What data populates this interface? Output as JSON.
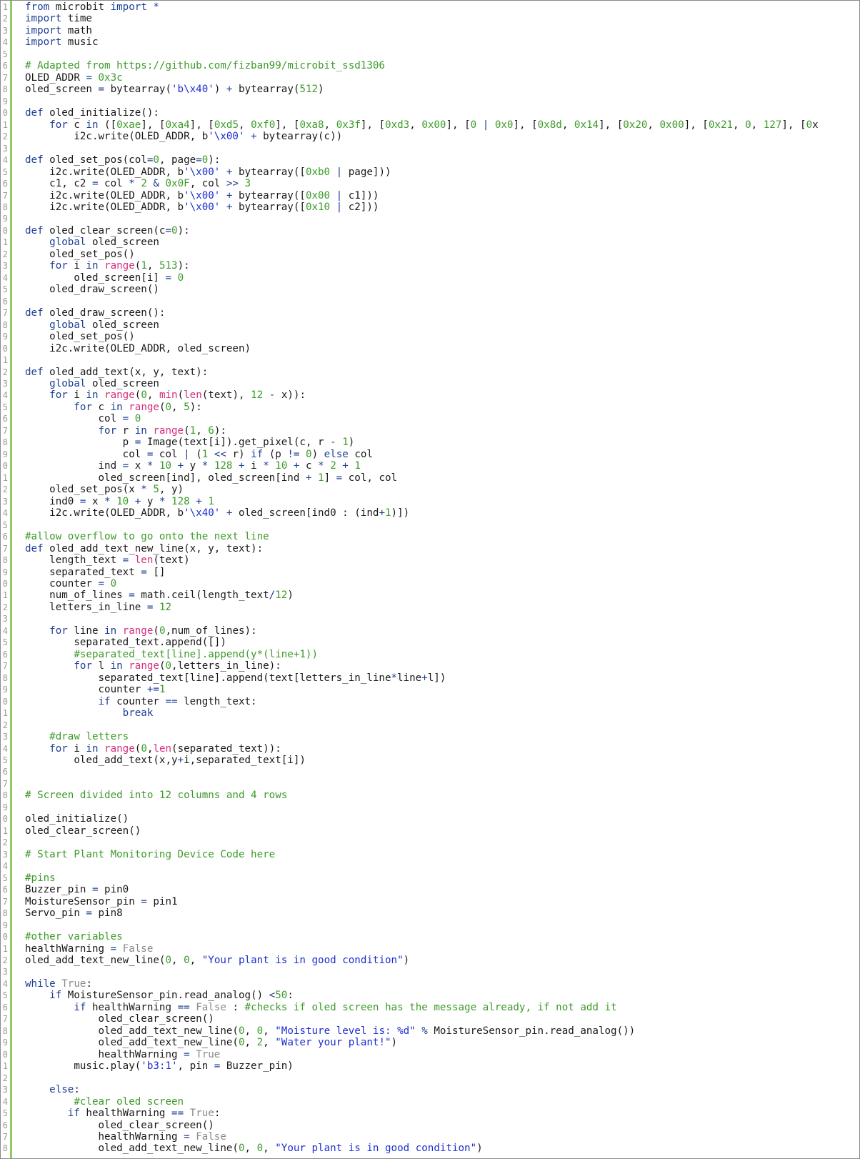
{
  "editor": {
    "language": "python",
    "colors": {
      "gutter_bar": "#8fca62",
      "keyword": "#1d3f95",
      "string": "#1b2fd0",
      "number": "#3d9b2a",
      "comment": "#3d9b2a",
      "builtin": "#d4307f",
      "literal": "#8a8a8a"
    },
    "lines": [
      {
        "n": "1",
        "t": "from microbit import *"
      },
      {
        "n": "2",
        "t": "import time"
      },
      {
        "n": "3",
        "t": "import math"
      },
      {
        "n": "4",
        "t": "import music"
      },
      {
        "n": "5",
        "t": ""
      },
      {
        "n": "6",
        "t": "# Adapted from https://github.com/fizban99/microbit_ssd1306"
      },
      {
        "n": "7",
        "t": "OLED_ADDR = 0x3c"
      },
      {
        "n": "8",
        "t": "oled_screen = bytearray('b\\x40') + bytearray(512)"
      },
      {
        "n": "9",
        "t": ""
      },
      {
        "n": "0",
        "t": "def oled_initialize():"
      },
      {
        "n": "1",
        "t": "    for c in ([0xae], [0xa4], [0xd5, 0xf0], [0xa8, 0x3f], [0xd3, 0x00], [0 | 0x0], [0x8d, 0x14], [0x20, 0x00], [0x21, 0, 127], [0x"
      },
      {
        "n": "2",
        "t": "        i2c.write(OLED_ADDR, b'\\x00' + bytearray(c))"
      },
      {
        "n": "3",
        "t": ""
      },
      {
        "n": "4",
        "t": "def oled_set_pos(col=0, page=0):"
      },
      {
        "n": "5",
        "t": "    i2c.write(OLED_ADDR, b'\\x00' + bytearray([0xb0 | page]))"
      },
      {
        "n": "6",
        "t": "    c1, c2 = col * 2 & 0x0F, col >> 3"
      },
      {
        "n": "7",
        "t": "    i2c.write(OLED_ADDR, b'\\x00' + bytearray([0x00 | c1]))"
      },
      {
        "n": "8",
        "t": "    i2c.write(OLED_ADDR, b'\\x00' + bytearray([0x10 | c2]))"
      },
      {
        "n": "9",
        "t": ""
      },
      {
        "n": "0",
        "t": "def oled_clear_screen(c=0):"
      },
      {
        "n": "1",
        "t": "    global oled_screen"
      },
      {
        "n": "2",
        "t": "    oled_set_pos()"
      },
      {
        "n": "3",
        "t": "    for i in range(1, 513):"
      },
      {
        "n": "4",
        "t": "        oled_screen[i] = 0"
      },
      {
        "n": "5",
        "t": "    oled_draw_screen()"
      },
      {
        "n": "6",
        "t": ""
      },
      {
        "n": "7",
        "t": "def oled_draw_screen():"
      },
      {
        "n": "8",
        "t": "    global oled_screen"
      },
      {
        "n": "9",
        "t": "    oled_set_pos()"
      },
      {
        "n": "0",
        "t": "    i2c.write(OLED_ADDR, oled_screen)"
      },
      {
        "n": "1",
        "t": ""
      },
      {
        "n": "2",
        "t": "def oled_add_text(x, y, text):"
      },
      {
        "n": "3",
        "t": "    global oled_screen"
      },
      {
        "n": "4",
        "t": "    for i in range(0, min(len(text), 12 - x)):"
      },
      {
        "n": "5",
        "t": "        for c in range(0, 5):"
      },
      {
        "n": "6",
        "t": "            col = 0"
      },
      {
        "n": "7",
        "t": "            for r in range(1, 6):"
      },
      {
        "n": "8",
        "t": "                p = Image(text[i]).get_pixel(c, r - 1)"
      },
      {
        "n": "9",
        "t": "                col = col | (1 << r) if (p != 0) else col"
      },
      {
        "n": "0",
        "t": "            ind = x * 10 + y * 128 + i * 10 + c * 2 + 1"
      },
      {
        "n": "1",
        "t": "            oled_screen[ind], oled_screen[ind + 1] = col, col"
      },
      {
        "n": "2",
        "t": "    oled_set_pos(x * 5, y)"
      },
      {
        "n": "3",
        "t": "    ind0 = x * 10 + y * 128 + 1"
      },
      {
        "n": "4",
        "t": "    i2c.write(OLED_ADDR, b'\\x40' + oled_screen[ind0 : (ind+1)])"
      },
      {
        "n": "5",
        "t": ""
      },
      {
        "n": "6",
        "t": "#allow overflow to go onto the next line"
      },
      {
        "n": "7",
        "t": "def oled_add_text_new_line(x, y, text):"
      },
      {
        "n": "8",
        "t": "    length_text = len(text)"
      },
      {
        "n": "9",
        "t": "    separated_text = []"
      },
      {
        "n": "0",
        "t": "    counter = 0"
      },
      {
        "n": "1",
        "t": "    num_of_lines = math.ceil(length_text/12)"
      },
      {
        "n": "2",
        "t": "    letters_in_line = 12"
      },
      {
        "n": "3",
        "t": ""
      },
      {
        "n": "4",
        "t": "    for line in range(0,num_of_lines):"
      },
      {
        "n": "5",
        "t": "        separated_text.append([])"
      },
      {
        "n": "6",
        "t": "        #separated_text[line].append(y*(line+1))"
      },
      {
        "n": "7",
        "t": "        for l in range(0,letters_in_line):"
      },
      {
        "n": "8",
        "t": "            separated_text[line].append(text[letters_in_line*line+l])"
      },
      {
        "n": "9",
        "t": "            counter +=1"
      },
      {
        "n": "0",
        "t": "            if counter == length_text:"
      },
      {
        "n": "1",
        "t": "                break"
      },
      {
        "n": "2",
        "t": ""
      },
      {
        "n": "3",
        "t": "    #draw letters"
      },
      {
        "n": "4",
        "t": "    for i in range(0,len(separated_text)):"
      },
      {
        "n": "5",
        "t": "        oled_add_text(x,y+i,separated_text[i])"
      },
      {
        "n": "6",
        "t": ""
      },
      {
        "n": "7",
        "t": ""
      },
      {
        "n": "8",
        "t": "# Screen divided into 12 columns and 4 rows"
      },
      {
        "n": "9",
        "t": ""
      },
      {
        "n": "0",
        "t": "oled_initialize()"
      },
      {
        "n": "1",
        "t": "oled_clear_screen()"
      },
      {
        "n": "2",
        "t": ""
      },
      {
        "n": "3",
        "t": "# Start Plant Monitoring Device Code here"
      },
      {
        "n": "4",
        "t": ""
      },
      {
        "n": "5",
        "t": "#pins"
      },
      {
        "n": "6",
        "t": "Buzzer_pin = pin0"
      },
      {
        "n": "7",
        "t": "MoistureSensor_pin = pin1"
      },
      {
        "n": "8",
        "t": "Servo_pin = pin8"
      },
      {
        "n": "9",
        "t": ""
      },
      {
        "n": "0",
        "t": "#other variables"
      },
      {
        "n": "1",
        "t": "healthWarning = False"
      },
      {
        "n": "2",
        "t": "oled_add_text_new_line(0, 0, \"Your plant is in good condition\")"
      },
      {
        "n": "3",
        "t": ""
      },
      {
        "n": "4",
        "t": "while True:"
      },
      {
        "n": "5",
        "t": "    if MoistureSensor_pin.read_analog() <50:"
      },
      {
        "n": "6",
        "t": "        if healthWarning == False : #checks if oled screen has the message already, if not add it"
      },
      {
        "n": "7",
        "t": "            oled_clear_screen()"
      },
      {
        "n": "8",
        "t": "            oled_add_text_new_line(0, 0, \"Moisture level is: %d\" % MoistureSensor_pin.read_analog())"
      },
      {
        "n": "9",
        "t": "            oled_add_text_new_line(0, 2, \"Water your plant!\")"
      },
      {
        "n": "0",
        "t": "            healthWarning = True"
      },
      {
        "n": "1",
        "t": "        music.play('b3:1', pin = Buzzer_pin)"
      },
      {
        "n": "2",
        "t": ""
      },
      {
        "n": "3",
        "t": "    else:"
      },
      {
        "n": "4",
        "t": "        #clear oled screen"
      },
      {
        "n": "5",
        "t": "       if healthWarning == True:"
      },
      {
        "n": "6",
        "t": "            oled_clear_screen()"
      },
      {
        "n": "7",
        "t": "            healthWarning = False"
      },
      {
        "n": "8",
        "t": "            oled_add_text_new_line(0, 0, \"Your plant is in good condition\")"
      }
    ]
  }
}
